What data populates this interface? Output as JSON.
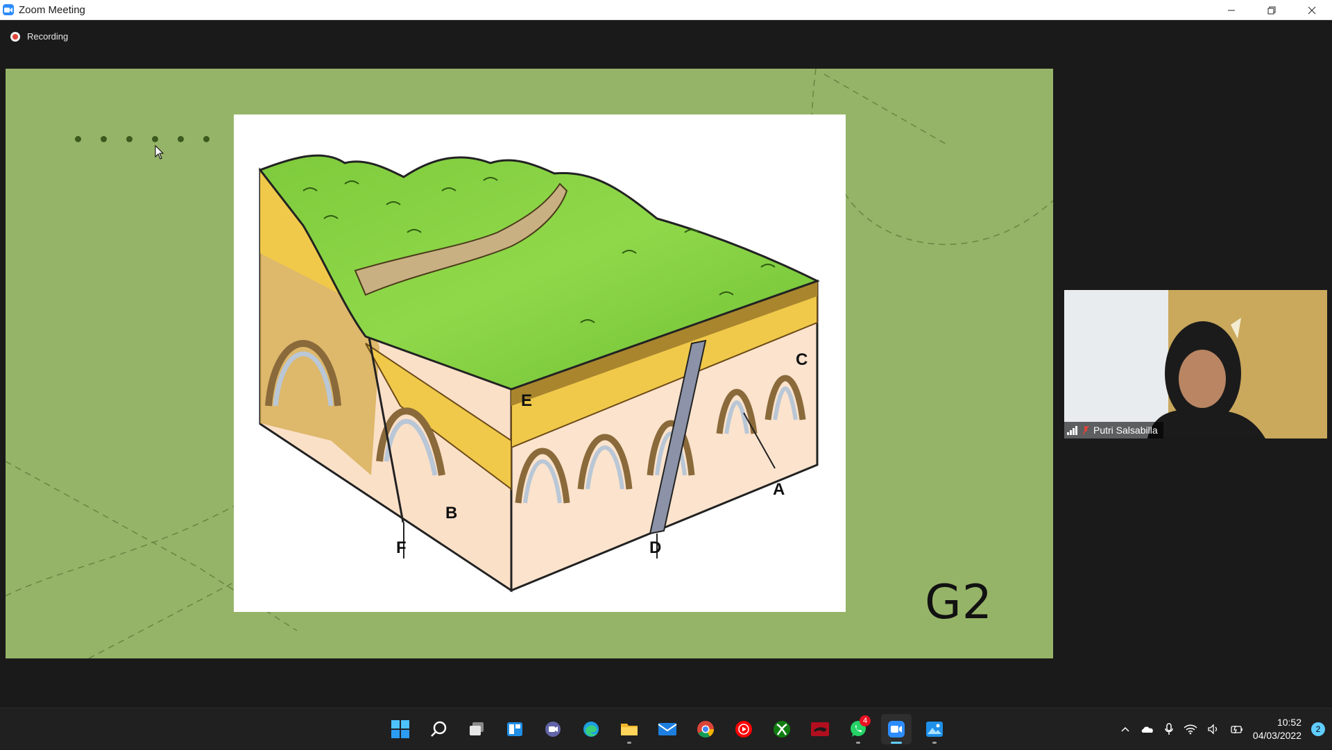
{
  "window": {
    "title": "Zoom Meeting",
    "controls": {
      "minimize": "–",
      "restore": "❐",
      "close": "✕"
    }
  },
  "recording": {
    "label": "Recording"
  },
  "slide": {
    "slide_label": "G2",
    "figure_labels": {
      "a": "A",
      "b": "B",
      "c": "C",
      "d": "D",
      "e": "E",
      "f": "F"
    }
  },
  "participant": {
    "name": "Putri Salsabilla",
    "audio_status": "muted"
  },
  "taskbar": {
    "apps": [
      {
        "name": "start-icon"
      },
      {
        "name": "search-icon"
      },
      {
        "name": "task-view-icon"
      },
      {
        "name": "widgets-icon"
      },
      {
        "name": "teams-chat-icon"
      },
      {
        "name": "edge-icon"
      },
      {
        "name": "file-explorer-icon"
      },
      {
        "name": "mail-icon"
      },
      {
        "name": "chrome-icon"
      },
      {
        "name": "youtube-music-icon"
      },
      {
        "name": "xbox-icon"
      },
      {
        "name": "red-app-icon"
      },
      {
        "name": "whatsapp-icon",
        "badge": "4"
      },
      {
        "name": "zoom-icon"
      },
      {
        "name": "photos-icon"
      }
    ],
    "clock": {
      "time": "10:52",
      "date": "04/03/2022"
    },
    "notifications": "2"
  },
  "colors": {
    "slide_bg": "#96b468",
    "zoom_blue": "#2D8CFF",
    "taskbar_bg": "#202020"
  }
}
